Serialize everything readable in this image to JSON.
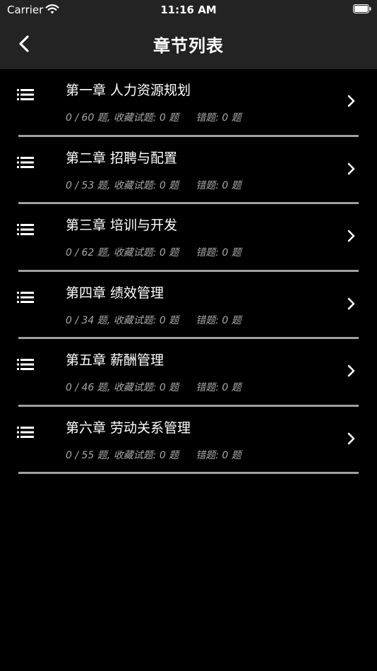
{
  "status_bar": {
    "carrier": "Carrier",
    "time": "11:16 AM"
  },
  "nav": {
    "title": "章节列表",
    "back_icon": "chevron-left-icon"
  },
  "chapters": [
    {
      "title": "第一章 人力资源规划",
      "progress": "0 / 60 题,",
      "favorites": "收藏试题: 0 题",
      "errors": "错题: 0 题"
    },
    {
      "title": "第二章 招聘与配置",
      "progress": "0 / 53 题,",
      "favorites": "收藏试题: 0 题",
      "errors": "错题: 0 题"
    },
    {
      "title": "第三章 培训与开发",
      "progress": "0 / 62 题,",
      "favorites": "收藏试题: 0 题",
      "errors": "错题: 0 题"
    },
    {
      "title": "第四章 绩效管理",
      "progress": "0 / 34 题,",
      "favorites": "收藏试题: 0 题",
      "errors": "错题: 0 题"
    },
    {
      "title": "第五章 薪酬管理",
      "progress": "0 / 46 题,",
      "favorites": "收藏试题: 0 题",
      "errors": "错题: 0 题"
    },
    {
      "title": "第六章 劳动关系管理",
      "progress": "0 / 55 题,",
      "favorites": "收藏试题: 0 题",
      "errors": "错题: 0 题"
    }
  ],
  "colors": {
    "bar_background": "#232323",
    "page_background": "#000000",
    "text_primary": "#ffffff",
    "text_secondary": "#a8a8a8",
    "divider": "#a0a0a0"
  },
  "icons": {
    "row_leading": "list-icon",
    "row_trailing": "chevron-right-icon"
  }
}
